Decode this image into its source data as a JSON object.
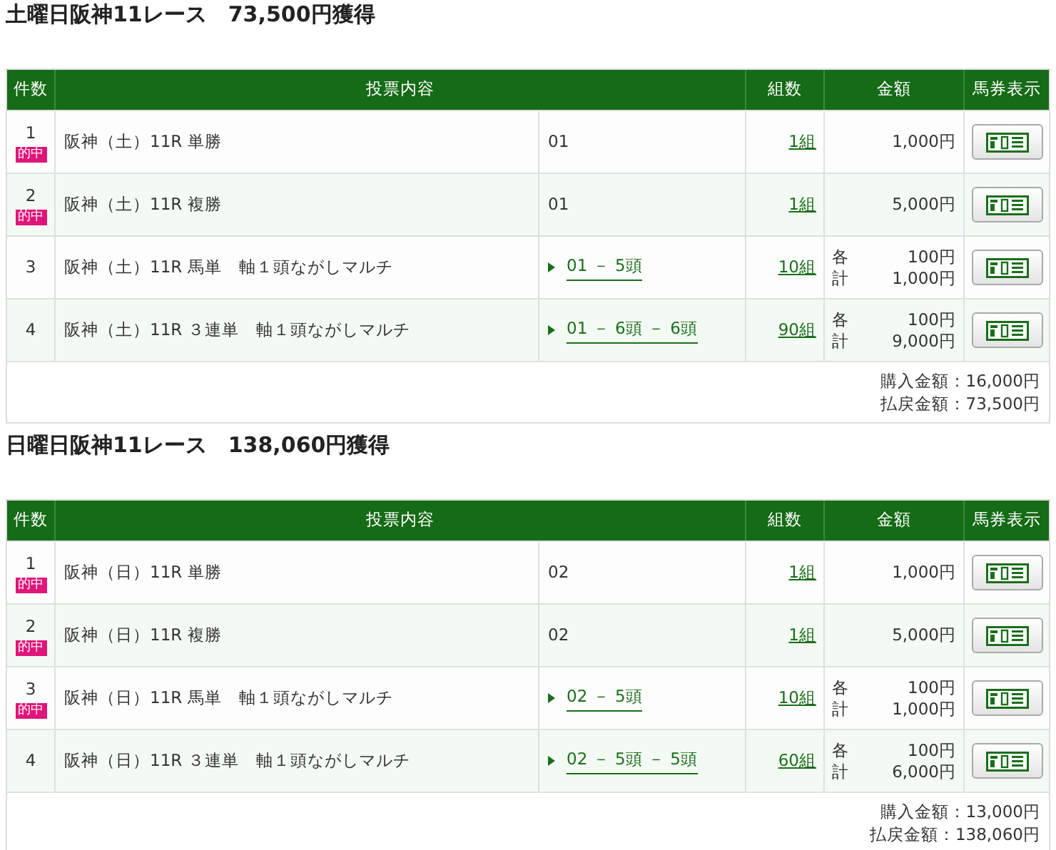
{
  "sections": [
    {
      "title": "土曜日阪神11レース　73,500円獲得",
      "columns": [
        "件数",
        "投票内容",
        "組数",
        "金額",
        "馬券表示"
      ],
      "rows": [
        {
          "number": "1",
          "hit": true,
          "hit_label": "的中",
          "content": "阪神（土）11R 単勝",
          "selection": {
            "kind": "plain",
            "text": "01"
          },
          "combos": "1組",
          "amount": {
            "kind": "single",
            "value": "1,000円"
          }
        },
        {
          "number": "2",
          "hit": true,
          "hit_label": "的中",
          "content": "阪神（土）11R 複勝",
          "selection": {
            "kind": "plain",
            "text": "01"
          },
          "combos": "1組",
          "amount": {
            "kind": "single",
            "value": "5,000円"
          }
        },
        {
          "number": "3",
          "hit": false,
          "content": "阪神（土）11R 馬単　軸１頭ながしマルチ",
          "selection": {
            "kind": "expand",
            "text": "01 － 5頭"
          },
          "combos": "10組",
          "amount": {
            "kind": "split",
            "each_label": "各",
            "each": "100円",
            "total_label": "計",
            "total": "1,000円"
          }
        },
        {
          "number": "4",
          "hit": false,
          "content": "阪神（土）11R ３連単　軸１頭ながしマルチ",
          "selection": {
            "kind": "expand",
            "text": "01 － 6頭 － 6頭"
          },
          "combos": "90組",
          "amount": {
            "kind": "split",
            "each_label": "各",
            "each": "100円",
            "total_label": "計",
            "total": "9,000円"
          }
        }
      ],
      "summary": [
        "購入金額：16,000円",
        "払戻金額：73,500円"
      ]
    },
    {
      "title": "日曜日阪神11レース　138,060円獲得",
      "columns": [
        "件数",
        "投票内容",
        "組数",
        "金額",
        "馬券表示"
      ],
      "rows": [
        {
          "number": "1",
          "hit": true,
          "hit_label": "的中",
          "content": "阪神（日）11R 単勝",
          "selection": {
            "kind": "plain",
            "text": "02"
          },
          "combos": "1組",
          "amount": {
            "kind": "single",
            "value": "1,000円"
          }
        },
        {
          "number": "2",
          "hit": true,
          "hit_label": "的中",
          "content": "阪神（日）11R 複勝",
          "selection": {
            "kind": "plain",
            "text": "02"
          },
          "combos": "1組",
          "amount": {
            "kind": "single",
            "value": "5,000円"
          }
        },
        {
          "number": "3",
          "hit": true,
          "hit_label": "的中",
          "content": "阪神（日）11R 馬単　軸１頭ながしマルチ",
          "selection": {
            "kind": "expand",
            "text": "02 － 5頭"
          },
          "combos": "10組",
          "amount": {
            "kind": "split",
            "each_label": "各",
            "each": "100円",
            "total_label": "計",
            "total": "1,000円"
          }
        },
        {
          "number": "4",
          "hit": false,
          "content": "阪神（日）11R ３連単　軸１頭ながしマルチ",
          "selection": {
            "kind": "expand",
            "text": "02 － 5頭 － 5頭"
          },
          "combos": "60組",
          "amount": {
            "kind": "split",
            "each_label": "各",
            "each": "100円",
            "total_label": "計",
            "total": "6,000円"
          }
        }
      ],
      "summary": [
        "購入金額：13,000円",
        "払戻金額：138,060円"
      ]
    }
  ]
}
